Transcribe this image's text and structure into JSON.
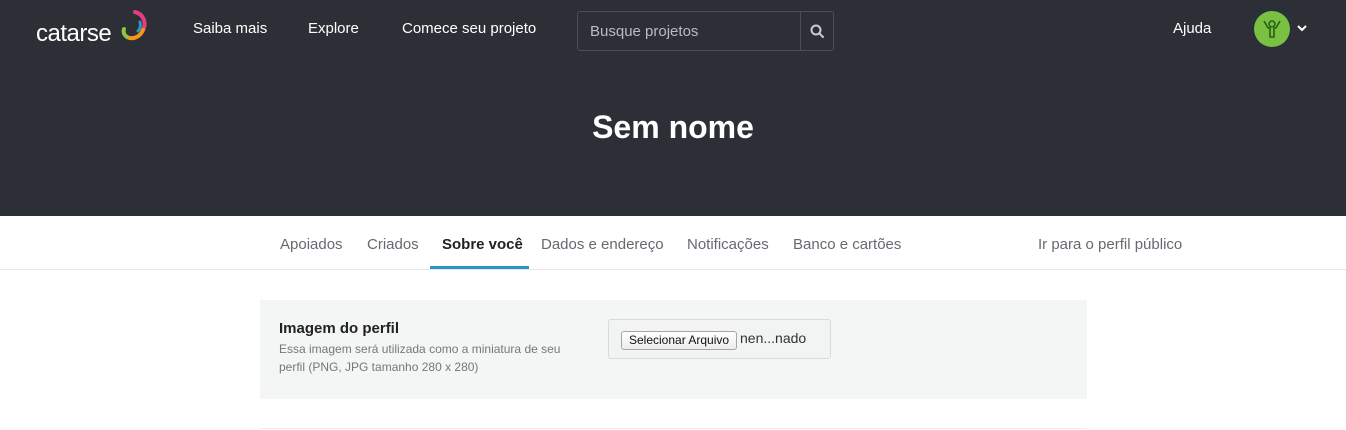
{
  "header": {
    "logo_text": "catarse",
    "nav": {
      "saiba": "Saiba mais",
      "explore": "Explore",
      "comece": "Comece seu projeto",
      "ajuda": "Ajuda"
    },
    "search": {
      "placeholder": "Busque projetos",
      "value": ""
    },
    "colors": {
      "background": "#2c2f35",
      "avatar": "#7ac143"
    }
  },
  "hero": {
    "title": "Sem nome"
  },
  "tabs": {
    "items": [
      {
        "label": "Apoiados"
      },
      {
        "label": "Criados"
      },
      {
        "label": "Sobre você"
      },
      {
        "label": "Dados e endereço"
      },
      {
        "label": "Notificações"
      },
      {
        "label": "Banco e cartões"
      }
    ],
    "active": "Sobre você",
    "public_profile": "Ir para o perfil público",
    "accent": "#2a97c6"
  },
  "profile_image": {
    "title": "Imagem do perfil",
    "description": "Essa imagem será utilizada como a miniatura de seu perfil (PNG, JPG tamanho 280 x 280)",
    "file_button": "Selecionar Arquivo",
    "file_name": "nen...nado"
  }
}
